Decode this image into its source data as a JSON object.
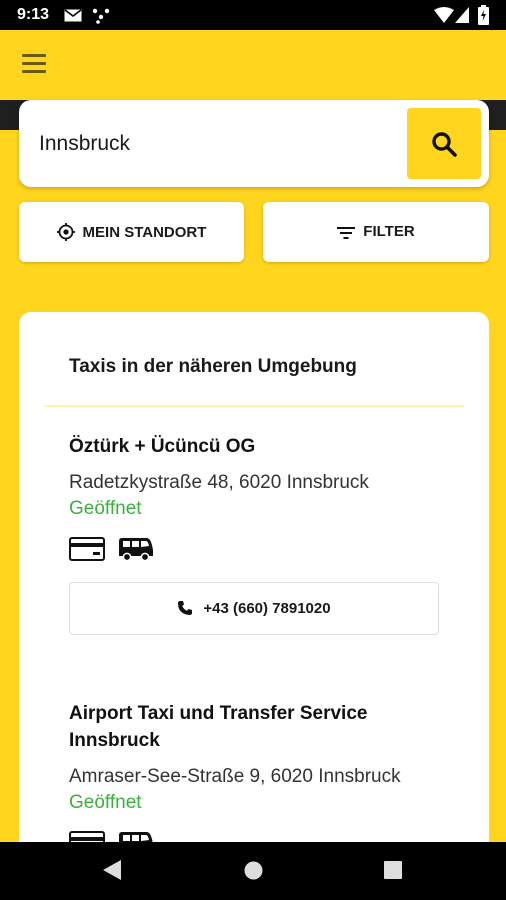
{
  "status_bar": {
    "time": "9:13"
  },
  "search": {
    "value": "Innsbruck"
  },
  "actions": {
    "location_label": "MEIN STANDORT",
    "filter_label": "FILTER"
  },
  "list": {
    "title": "Taxis in der näheren Umgebung",
    "entries": [
      {
        "name": "Öztürk + Ücüncü OG",
        "address": "Radetzkystraße 48, 6020 Innsbruck",
        "status": "Geöffnet",
        "phone": "+43 (660) 7891020",
        "features": [
          "credit-card-icon",
          "van-icon"
        ]
      },
      {
        "name": "Airport Taxi und Transfer Service Innsbruck",
        "address": "Amraser-See-Straße 9, 6020 Innsbruck",
        "status": "Geöffnet",
        "features": [
          "credit-card-icon",
          "van-icon"
        ]
      }
    ]
  },
  "colors": {
    "brand_yellow": "#FFD51E",
    "open_green": "#3EB03E"
  }
}
